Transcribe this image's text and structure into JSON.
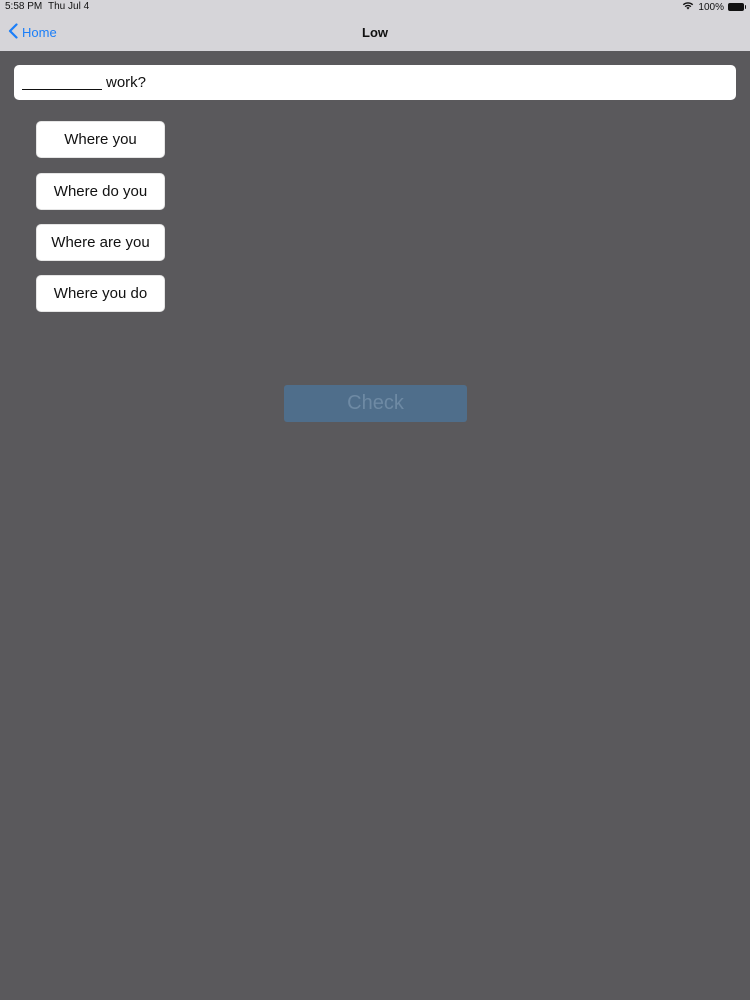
{
  "status_bar": {
    "time": "5:58 PM",
    "date": "Thu Jul 4",
    "battery_text": "100%",
    "icons": [
      "wifi-icon",
      "battery-icon"
    ]
  },
  "nav": {
    "back_label": "Home",
    "title": "Low"
  },
  "question": {
    "text": "work?"
  },
  "options": [
    "Where you",
    "Where do you",
    "Where are you",
    "Where you do"
  ],
  "check_label": "Check",
  "colors": {
    "background": "#5a595c",
    "nav_background": "#d6d5d9",
    "accent": "#1b7ef8",
    "check_bg": "#4f6e8b"
  }
}
